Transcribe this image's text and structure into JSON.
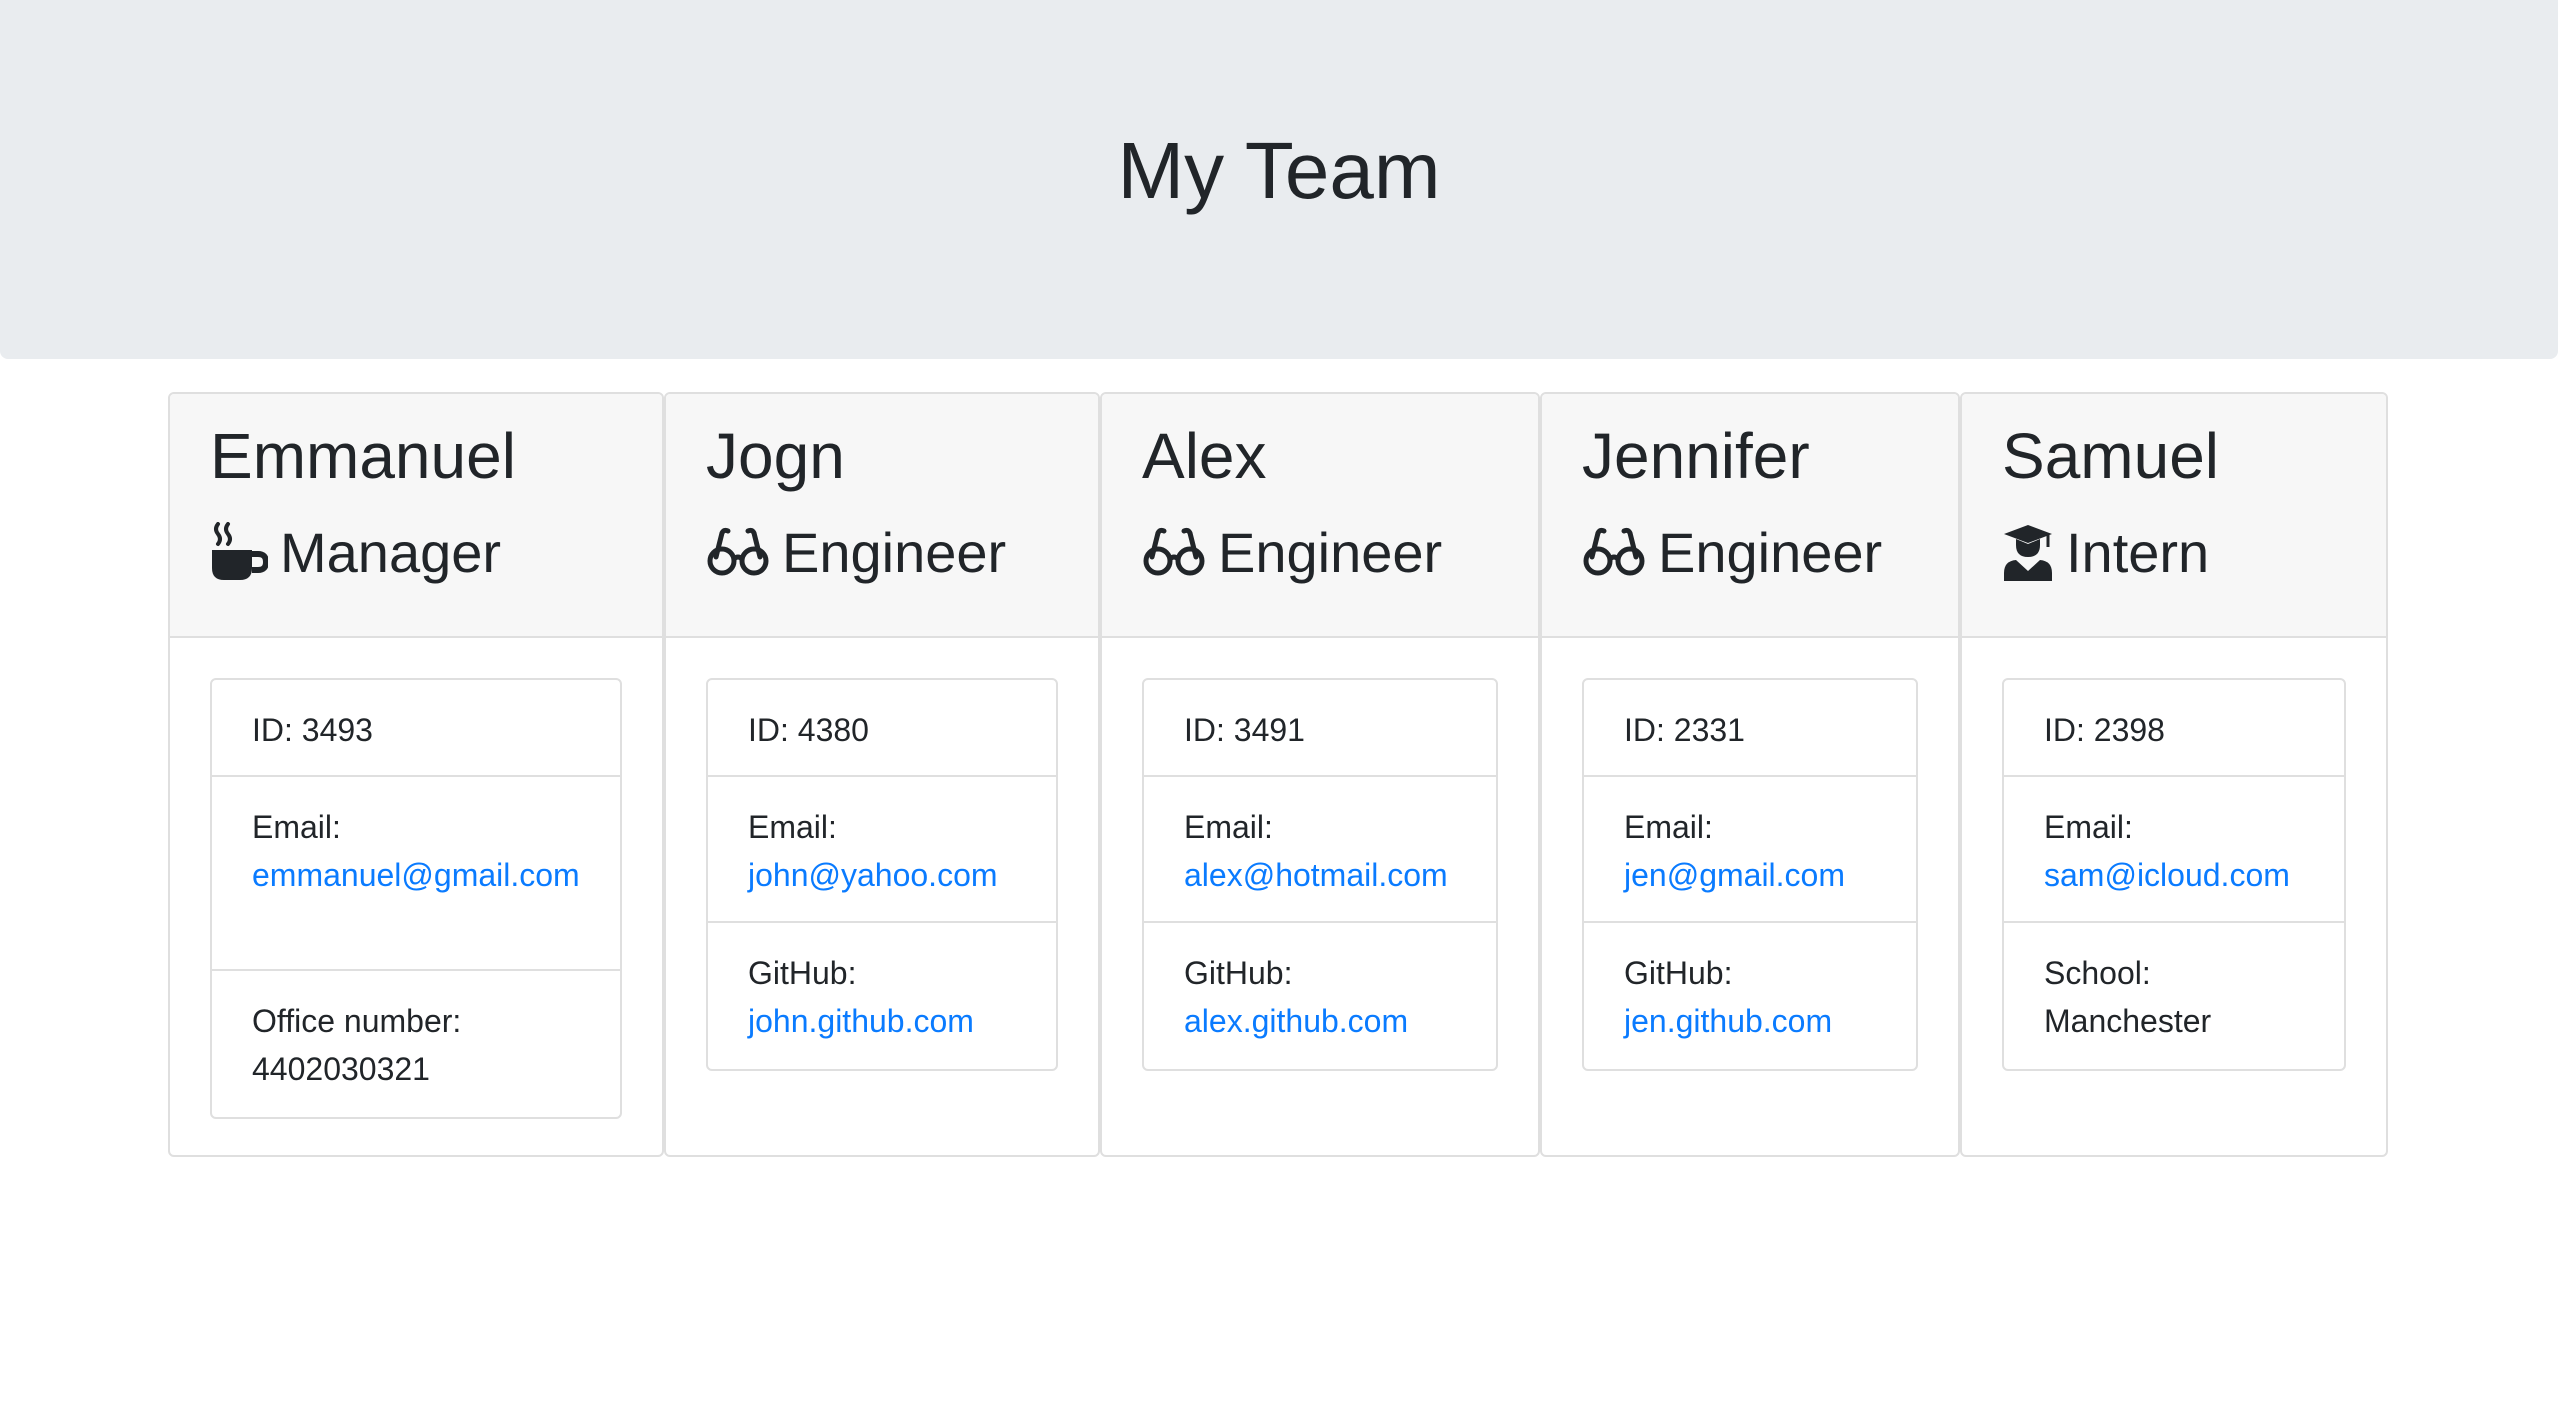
{
  "header": {
    "title": "My Team"
  },
  "team": [
    {
      "name": "Emmanuel",
      "role": "Manager",
      "role_icon": "coffee-mug-icon",
      "id_text": "ID: 3493",
      "email_label": "Email:",
      "email": "emmanuel@gmail.com",
      "extra_label": "Office number:",
      "extra_value": "4402030321"
    },
    {
      "name": "Jogn",
      "role": "Engineer",
      "role_icon": "glasses-icon",
      "id_text": "ID: 4380",
      "email_label": "Email:",
      "email": "john@yahoo.com",
      "extra_label": "GitHub:",
      "extra_value": "john.github.com"
    },
    {
      "name": "Alex",
      "role": "Engineer",
      "role_icon": "glasses-icon",
      "id_text": "ID: 3491",
      "email_label": "Email:",
      "email": "alex@hotmail.com",
      "extra_label": "GitHub:",
      "extra_value": "alex.github.com"
    },
    {
      "name": "Jennifer",
      "role": "Engineer",
      "role_icon": "glasses-icon",
      "id_text": "ID: 2331",
      "email_label": "Email:",
      "email": "jen@gmail.com",
      "extra_label": "GitHub:",
      "extra_value": "jen.github.com"
    },
    {
      "name": "Samuel",
      "role": "Intern",
      "role_icon": "graduate-icon",
      "id_text": "ID: 2398",
      "email_label": "Email:",
      "email": "sam@icloud.com",
      "extra_label": "School:",
      "extra_value": "Manchester"
    }
  ],
  "colors": {
    "jumbotron_bg": "#e9ecef",
    "card_header_bg": "#f7f7f7",
    "link": "#0a7bff",
    "text": "#212529",
    "border": "#dfdfdf"
  }
}
